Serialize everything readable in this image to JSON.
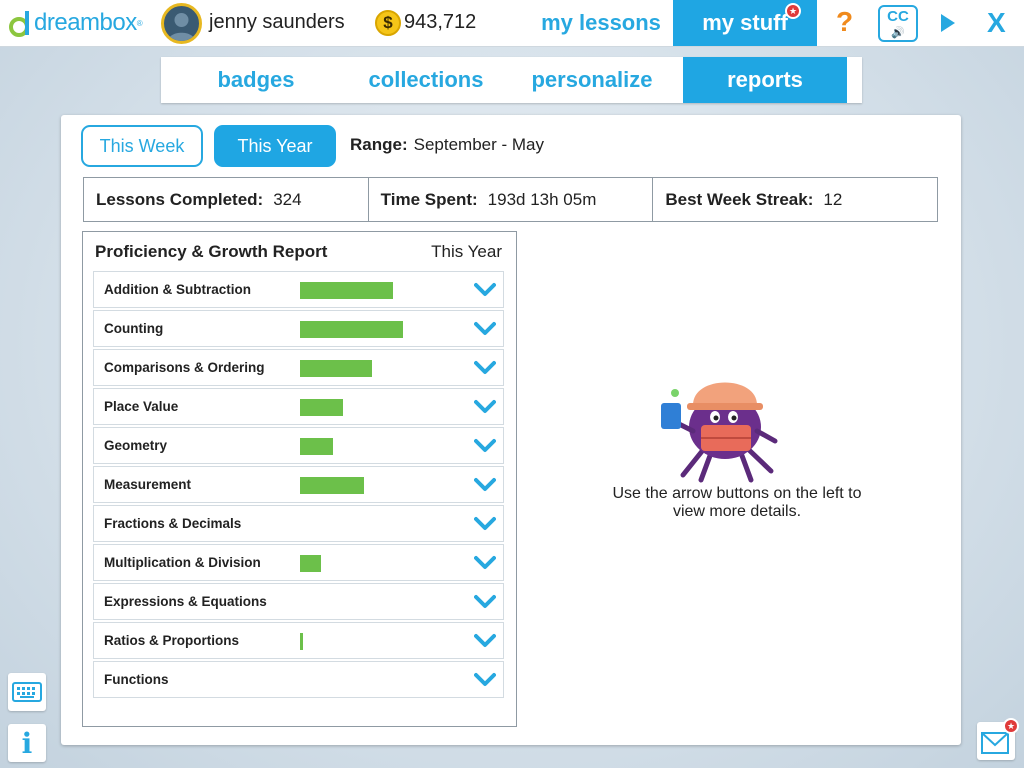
{
  "brand": {
    "name": "dreambox",
    "trademark": "®",
    "color": "#27a8e0"
  },
  "user": {
    "name": "jenny saunders",
    "coins": "943,712",
    "coin_symbol": "$"
  },
  "nav": {
    "my_lessons": "my lessons",
    "my_stuff": "my stuff",
    "help": "?",
    "cc_label": "CC",
    "cc_sub": "🔊",
    "close": "X"
  },
  "subtabs": [
    {
      "label": "badges",
      "active": false
    },
    {
      "label": "collections",
      "active": false
    },
    {
      "label": "personalize",
      "active": false
    },
    {
      "label": "reports",
      "active": true
    }
  ],
  "period": {
    "this_week": "This Week",
    "this_year": "This Year",
    "selected": "This Year"
  },
  "range": {
    "label": "Range:",
    "value": "September - May"
  },
  "stats": [
    {
      "label": "Lessons Completed:",
      "value": "324"
    },
    {
      "label": "Time Spent:",
      "value": "193d 13h 05m"
    },
    {
      "label": "Best Week Streak:",
      "value": "12"
    }
  ],
  "report": {
    "title": "Proficiency & Growth Report",
    "period": "This Year",
    "rows": [
      {
        "label": "Addition & Subtraction",
        "progress": 0.45
      },
      {
        "label": "Counting",
        "progress": 0.5
      },
      {
        "label": "Comparisons & Ordering",
        "progress": 0.35
      },
      {
        "label": "Place Value",
        "progress": 0.21
      },
      {
        "label": "Geometry",
        "progress": 0.16
      },
      {
        "label": "Measurement",
        "progress": 0.31
      },
      {
        "label": "Fractions & Decimals",
        "progress": 0
      },
      {
        "label": "Multiplication & Division",
        "progress": 0.1
      },
      {
        "label": "Expressions & Equations",
        "progress": 0
      },
      {
        "label": "Ratios & Proportions",
        "progress": 0.015
      },
      {
        "label": "Functions",
        "progress": 0
      }
    ],
    "bar_color": "#6cc04a",
    "chevron_color": "#27a8e0"
  },
  "details_hint": "Use the arrow buttons on the left to view more details."
}
